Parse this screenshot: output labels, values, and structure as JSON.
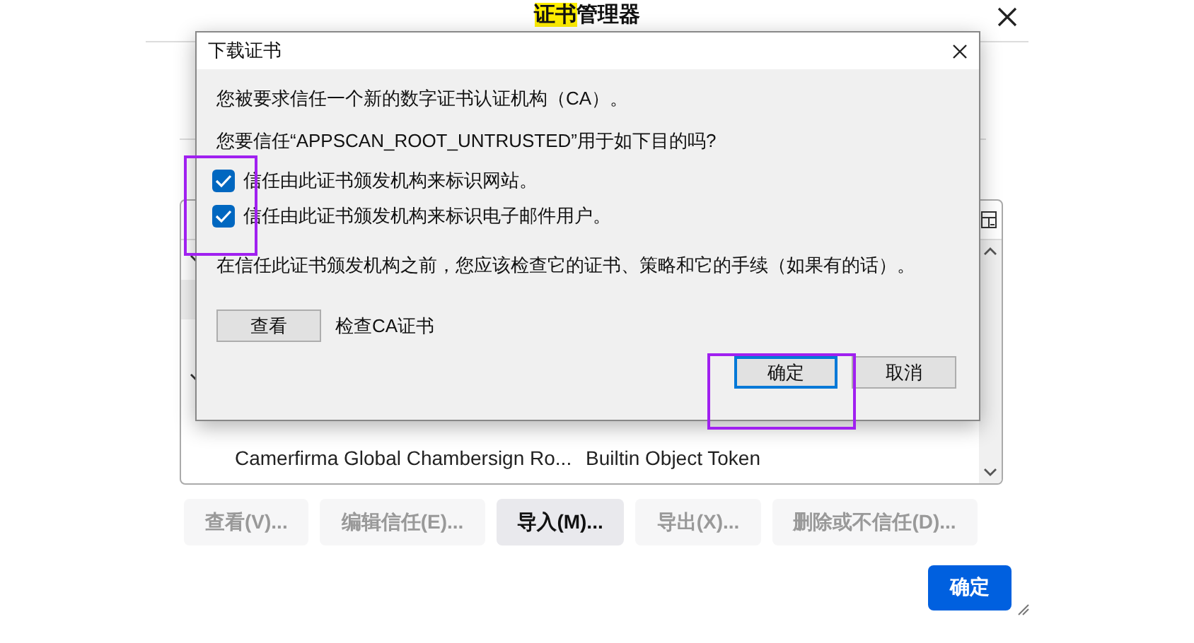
{
  "window": {
    "title": [
      {
        "text": "证书",
        "highlighted": true
      },
      {
        "text": "管理器",
        "highlighted": false
      }
    ]
  },
  "list": {
    "rows": [
      {
        "kind": "group",
        "expanded": true,
        "selected": false
      },
      {
        "kind": "blank",
        "selected": true
      },
      {
        "kind": "spacer"
      },
      {
        "kind": "group",
        "expanded": true,
        "selected": false
      },
      {
        "kind": "spacer"
      },
      {
        "kind": "cert",
        "name": "Camerfirma Global Chambersign Ro...",
        "token": "Builtin Object Token",
        "selected": false
      }
    ]
  },
  "buttons": [
    {
      "label": "查看(V)...",
      "disabled": true
    },
    {
      "label": "编辑信任(E)...",
      "disabled": true
    },
    {
      "label": "导入(M)...",
      "disabled": false
    },
    {
      "label": "导出(X)...",
      "disabled": true
    },
    {
      "label": "删除或不信任(D)...",
      "disabled": true
    }
  ],
  "ok_button": "确定",
  "dialog": {
    "title": "下载证书",
    "message": "您被要求信任一个新的数字证书认证机构（CA）。",
    "question": "您要信任“APPSCAN_ROOT_UNTRUSTED”用于如下目的吗?",
    "options": [
      {
        "label": "信任由此证书颁发机构来标识网站。",
        "checked": true
      },
      {
        "label": "信任由此证书颁发机构来标识电子邮件用户。",
        "checked": true
      }
    ],
    "advice": "在信任此证书颁发机构之前，您应该检查它的证书、策略和它的手续（如果有的话）。",
    "view_button": "查看",
    "view_hint": "检查CA证书",
    "ok_button": "确定",
    "cancel_button": "取消"
  }
}
